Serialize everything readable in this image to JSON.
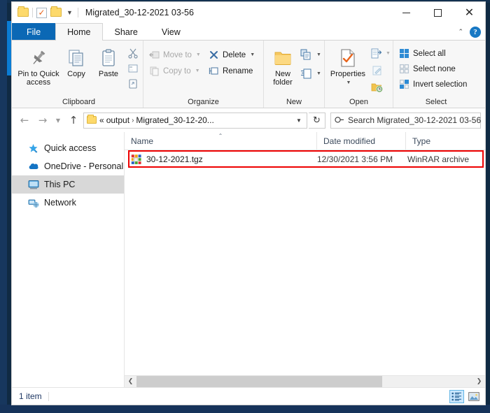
{
  "window": {
    "title": "Migrated_30-12-2021 03-56",
    "quick_access_toolbar": [
      {
        "name": "folder-icon",
        "label": "Folder"
      },
      {
        "name": "properties-icon",
        "label": "Properties"
      },
      {
        "name": "new-folder-icon",
        "label": "New folder"
      },
      {
        "name": "customize-dropdown",
        "label": "Customize Quick Access Toolbar"
      }
    ],
    "controls": {
      "minimize": "—",
      "maximize": "□",
      "close": "✕"
    }
  },
  "ribbon": {
    "tabs": [
      {
        "label": "File",
        "id": "file",
        "active": false,
        "is_file": true
      },
      {
        "label": "Home",
        "id": "home",
        "active": true,
        "is_file": false
      },
      {
        "label": "Share",
        "id": "share",
        "active": false,
        "is_file": false
      },
      {
        "label": "View",
        "id": "view",
        "active": false,
        "is_file": false
      }
    ],
    "collapse_caret": "⌃",
    "help_label": "?",
    "groups": {
      "clipboard": {
        "label": "Clipboard",
        "pin_to_quick_access": "Pin to Quick\naccess",
        "pin_line1": "Pin to Quick",
        "pin_line2": "access",
        "copy": "Copy",
        "paste": "Paste",
        "cut": "Cut",
        "copy_path": "Copy path",
        "paste_shortcut": "Paste shortcut"
      },
      "organize": {
        "label": "Organize",
        "move_to": "Move to",
        "copy_to": "Copy to",
        "delete": "Delete",
        "rename": "Rename"
      },
      "new": {
        "label": "New",
        "new_folder_line1": "New",
        "new_folder_line2": "folder",
        "new_item": "New item",
        "easy_access": "Easy access"
      },
      "open": {
        "label": "Open",
        "properties_line1": "Properties",
        "open_button": "Open",
        "edit": "Edit",
        "history": "History"
      },
      "select": {
        "label": "Select",
        "select_all": "Select all",
        "select_none": "Select none",
        "invert_selection": "Invert selection"
      }
    }
  },
  "addressbar": {
    "back_icon": "←",
    "forward_icon": "→",
    "recent_icon": "⌄",
    "up_icon": "↑",
    "breadcrumb_prefix": "«",
    "crumbs": [
      "output",
      "Migrated_30-12-20..."
    ],
    "crumb_separator": "›",
    "dropdown_icon": "⌄",
    "refresh_icon": "↻",
    "search_placeholder": "Search Migrated_30-12-2021 03-56",
    "search_icon": "⚲"
  },
  "navpane": {
    "items": [
      {
        "label": "Quick access",
        "icon": "star-pin-icon",
        "selected": false
      },
      {
        "label": "OneDrive - Personal",
        "icon": "cloud-icon",
        "selected": false
      },
      {
        "label": "This PC",
        "icon": "monitor-icon",
        "selected": true
      },
      {
        "label": "Network",
        "icon": "network-icon",
        "selected": false
      }
    ]
  },
  "filelist": {
    "columns": [
      {
        "label": "Name",
        "sorted": true,
        "sort_icon": "⌃"
      },
      {
        "label": "Date modified",
        "sorted": false,
        "sort_icon": ""
      },
      {
        "label": "Type",
        "sorted": false,
        "sort_icon": ""
      }
    ],
    "rows": [
      {
        "name": "30-12-2021.tgz",
        "date_modified": "12/30/2021 3:56 PM",
        "type": "WinRAR archive",
        "icon": "winrar-archive-icon",
        "highlighted": true
      }
    ],
    "highlight_color": "#ee0000"
  },
  "scrollbar": {
    "left_icon": "‹",
    "right_icon": "›"
  },
  "statusbar": {
    "item_count": "1 item",
    "views": [
      {
        "name": "details-view-button",
        "active": true
      },
      {
        "name": "large-icons-view-button",
        "active": false
      }
    ]
  },
  "colors": {
    "file_tab_blue": "#0b68b5",
    "accent_blue": "#0a7cd4",
    "highlight_red": "#ee0000",
    "status_text": "#1f3864",
    "selected_row": "#d8d8d8"
  }
}
